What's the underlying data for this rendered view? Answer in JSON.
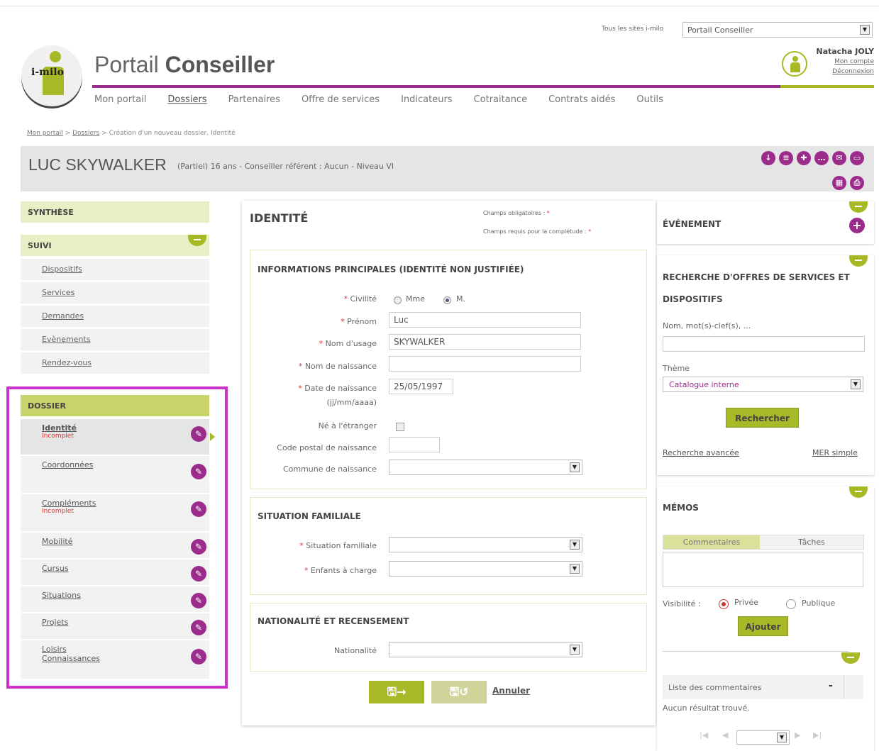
{
  "top": {
    "site_label": "Tous les sites i-milo",
    "site_select": "Portail Conseiller"
  },
  "logo": {
    "text": "i-milo"
  },
  "app": {
    "title_light": "Portail",
    "title_bold": "Conseiller"
  },
  "user": {
    "name": "Natacha JOLY",
    "account": "Mon compte",
    "logout": "Déconnexion"
  },
  "nav": [
    "Mon portail",
    "Dossiers",
    "Partenaires",
    "Offre de services",
    "Indicateurs",
    "Cotraitance",
    "Contrats aidés",
    "Outils"
  ],
  "breadcrumb": {
    "home": "Mon portail",
    "dossiers": "Dossiers",
    "sep": ">",
    "current": "Création d'un nouveau dossier, Identité"
  },
  "person": {
    "name": "LUC SKYWALKER",
    "info": "(Partiel) 16 ans - Conseiller référent : Aucun - Niveau VI"
  },
  "sidebar": {
    "synthese": "SYNTHÈSE",
    "suivi": "SUIVI",
    "suivi_items": [
      "Dispositifs",
      "Services",
      "Demandes",
      "Evènements",
      "Rendez-vous"
    ],
    "dossier": "DOSSIER",
    "dossier_items": [
      {
        "label": "Identité",
        "status": "Incomplet"
      },
      {
        "label": "Coordonnées",
        "status": ""
      },
      {
        "label": "Compléments",
        "status": "Incomplet"
      },
      {
        "label": "Mobilité",
        "status": ""
      },
      {
        "label": "Cursus",
        "status": ""
      },
      {
        "label": "Situations",
        "status": ""
      },
      {
        "label": "Projets",
        "status": ""
      },
      {
        "label": "Loisirs",
        "label2": "Connaissances",
        "status": ""
      }
    ]
  },
  "form": {
    "title": "IDENTITÉ",
    "required_note": "Champs obligatoires :",
    "completeness_note": "Champs requis pour la complétude :",
    "star": "*",
    "section1": "INFORMATIONS PRINCIPALES (IDENTITÉ NON JUSTIFIÉE)",
    "civilite": "Civilité",
    "mme": "Mme",
    "m": "M.",
    "prenom": "Prénom",
    "prenom_value": "Luc",
    "nom_usage": "Nom d'usage",
    "nom_usage_value": "SKYWALKER",
    "nom_naissance": "Nom de naissance",
    "nom_naissance_value": "",
    "date_naissance": "Date de naissance",
    "date_format": "(jj/mm/aaaa)",
    "date_value": "25/05/1997",
    "ne_etranger": "Né à l'étranger",
    "code_postal": "Code postal de naissance",
    "commune": "Commune de naissance",
    "section2": "SITUATION FAMILIALE",
    "situation": "Situation familiale",
    "enfants": "Enfants à charge",
    "section3": "NATIONALITÉ ET RECENSEMENT",
    "nationalite": "Nationalité",
    "cancel": "Annuler"
  },
  "right": {
    "evenement": "ÉVÉNEMENT",
    "recherche_title1": "RECHERCHE D'OFFRES DE SERVICES ET",
    "recherche_title2": "DISPOSITIFS",
    "search_label": "Nom, mot(s)-clef(s), ...",
    "theme_label": "Thème",
    "theme_value": "Catalogue interne",
    "search_btn": "Rechercher",
    "advanced": "Recherche avancée",
    "mer": "MER simple",
    "memos": "MÉMOS",
    "tab_comments": "Commentaires",
    "tab_tasks": "Tâches",
    "visibility": "Visibilité :",
    "private": "Privée",
    "public": "Publique",
    "add_btn": "Ajouter",
    "list_title": "Liste des commentaires",
    "collapse": "-",
    "no_result": "Aucun résultat trouvé."
  }
}
